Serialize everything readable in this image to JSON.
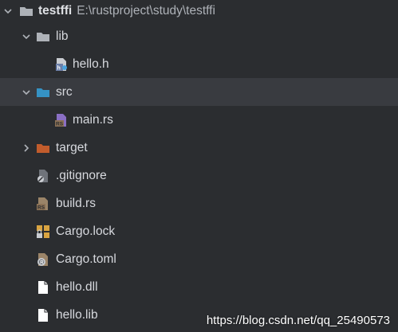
{
  "root": {
    "name": "testffi",
    "path": "E:\\rustproject\\study\\testffi"
  },
  "items": [
    {
      "label": "lib",
      "icon": "folder-icon"
    },
    {
      "label": "hello.h",
      "icon": "c-header-file-icon"
    },
    {
      "label": "src",
      "icon": "source-folder-icon"
    },
    {
      "label": "main.rs",
      "icon": "rust-file-icon"
    },
    {
      "label": "target",
      "icon": "excluded-folder-icon"
    },
    {
      "label": ".gitignore",
      "icon": "gitignore-file-icon"
    },
    {
      "label": "build.rs",
      "icon": "rust-file-icon"
    },
    {
      "label": "Cargo.lock",
      "icon": "lock-file-icon"
    },
    {
      "label": "Cargo.toml",
      "icon": "toml-file-icon"
    },
    {
      "label": "hello.dll",
      "icon": "file-icon"
    },
    {
      "label": "hello.lib",
      "icon": "file-icon"
    }
  ],
  "watermark": "https://blog.csdn.net/qq_25490573",
  "colors": {
    "background": "#2b2d30",
    "selected_row": "#393b40",
    "folder": "#aeb2b8",
    "source_folder": "#3592c4",
    "excluded_folder": "#c15c2c"
  }
}
